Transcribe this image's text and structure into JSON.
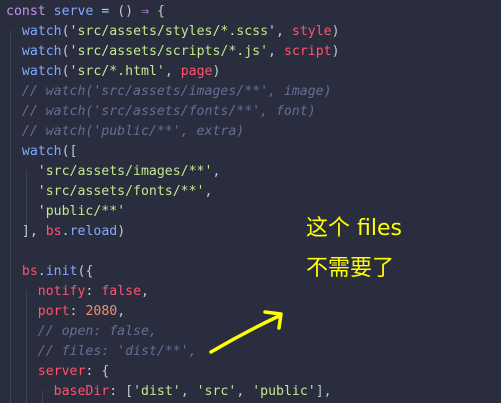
{
  "code": {
    "l1": {
      "a": "const",
      "b": "serve",
      "c": "=",
      "d": "()",
      "e": "⇒",
      "f": "{"
    },
    "l2": {
      "fn": "watch",
      "p1": "(",
      "s": "'src/assets/styles/*.scss'",
      "p2": ",",
      "v": "style",
      "p3": ")"
    },
    "l3": {
      "fn": "watch",
      "p1": "(",
      "s": "'src/assets/scripts/*.js'",
      "p2": ",",
      "v": "script",
      "p3": ")"
    },
    "l4": {
      "fn": "watch",
      "p1": "(",
      "s": "'src/*.html'",
      "p2": ",",
      "v": "page",
      "p3": ")"
    },
    "l5": "// watch('src/assets/images/**', image)",
    "l6": "// watch('src/assets/fonts/**', font)",
    "l7": "// watch('public/**', extra)",
    "l8": {
      "fn": "watch",
      "p": "(["
    },
    "l9": {
      "s": "'src/assets/images/**'",
      "p": ","
    },
    "l10": {
      "s": "'src/assets/fonts/**'",
      "p": ","
    },
    "l11": {
      "s": "'public/**'"
    },
    "l12": {
      "a": "],",
      "obj": "bs",
      "dot": ".",
      "m": "reload",
      "c": ")"
    },
    "l14": {
      "obj": "bs",
      "dot": ".",
      "m": "init",
      "p": "({"
    },
    "l15": {
      "k": "notify",
      "c": ":",
      "v": "false",
      "e": ","
    },
    "l16": {
      "k": "port",
      "c": ":",
      "v": "2080",
      "e": ","
    },
    "l17": "// open: false,",
    "l18": "// files: 'dist/**',",
    "l19": {
      "k": "server",
      "c": ":",
      "b": "{"
    },
    "l20": {
      "k": "baseDir",
      "c": ":",
      "o": "[",
      "s1": "'dist'",
      "s2": "'src'",
      "s3": "'public'",
      "e": "],"
    }
  },
  "annotation": {
    "line1": "这个 files",
    "line2": "不需要了",
    "color": "#ffff00"
  },
  "theme": {
    "background": "#292d3e",
    "keyword": "#c792ea",
    "function": "#82aaff",
    "string": "#c3e88d",
    "property": "#ff5370",
    "number": "#f78c6c",
    "comment": "#676e95"
  }
}
